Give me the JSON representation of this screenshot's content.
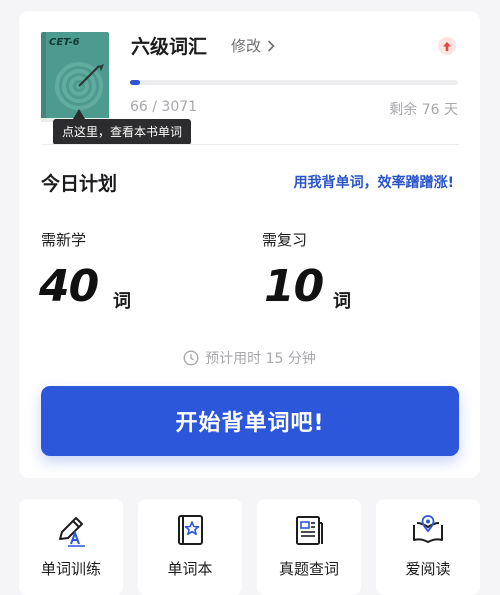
{
  "book": {
    "level_tag": "CET-6",
    "title": "六级词汇",
    "edit_label": "修改",
    "progress_text": "66 / 3071",
    "progress_fraction": 0.0215,
    "days_left": "剩余 76 天",
    "tooltip": "点这里，查看本书单词",
    "cover_color": "#4d9a8e"
  },
  "plan": {
    "title": "今日计划",
    "promo": "用我背单词，效率蹭蹭涨!",
    "new": {
      "label": "需新学",
      "value": "40",
      "unit": "词"
    },
    "review": {
      "label": "需复习",
      "value": "10",
      "unit": "词"
    },
    "estimate": "预计用时 15 分钟",
    "start_label": "开始背单词吧!"
  },
  "tools": [
    {
      "label": "单词训练",
      "icon": "pencil-icon"
    },
    {
      "label": "单词本",
      "icon": "notebook-icon"
    },
    {
      "label": "真题查词",
      "icon": "newspaper-icon"
    },
    {
      "label": "爱阅读",
      "icon": "open-book-icon"
    }
  ],
  "colors": {
    "accent": "#2d57db",
    "link": "#2a55c9",
    "alert": "#e0473f"
  }
}
